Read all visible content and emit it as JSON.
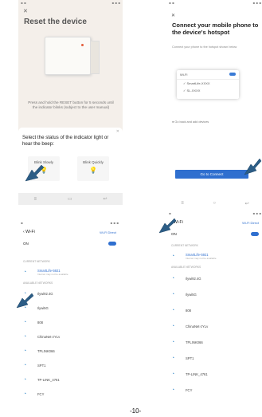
{
  "screen1": {
    "title": "Reset the device",
    "description": "Press and hold the RESET button for 5 seconds until the indicator blinks (subject to the user manual)",
    "prompt": "Select the status of the indicator light or hear the beep:",
    "options": [
      "Blink Slowly",
      "Blink Quickly"
    ]
  },
  "screen2": {
    "title": "Connect your mobile phone to the device's hotspot",
    "subtitle": "Connect your phone to the hotspot shown below",
    "wifi_header": "Wi-Fi",
    "networks": [
      "SmartLife-XXXX",
      "SL-XXXX"
    ],
    "note": "Go back and add devices",
    "button": "Go to Connect"
  },
  "screen3": {
    "title": "Wi-Fi",
    "direct": "Wi-Fi Direct",
    "on_label": "ON",
    "current_section": "CURRENT NETWORK",
    "current": {
      "name": "SmartLife-5921",
      "sub": "Internet may not be available"
    },
    "available_section": "AVAILABLE NETWORKS",
    "networks": [
      "Ilywi92.4G",
      "Ilywi5G",
      "808",
      "ChinaNet-zYLv",
      "TPLINK066",
      "SPT1",
      "TP-LINK_4761",
      "FCY"
    ]
  },
  "screen4": {
    "title": "Wi-Fi",
    "direct": "Wi-Fi Direct",
    "on_label": "ON",
    "current_section": "CURRENT NETWORK",
    "current": {
      "name": "SmartLife-5921",
      "sub": "Internet may not be available"
    },
    "available_section": "AVAILABLE NETWORKS",
    "networks": [
      "Ilywi92.4G",
      "Ilywi5G",
      "808",
      "ChinaNet-zYLv",
      "TPLINK066",
      "SPT1",
      "TP-LINK_4761",
      "FCY"
    ]
  },
  "page_number": "-10-",
  "colors": {
    "accent": "#2f6fcf",
    "arrow": "#2c5d86",
    "wifi": "#5a9fd4"
  }
}
